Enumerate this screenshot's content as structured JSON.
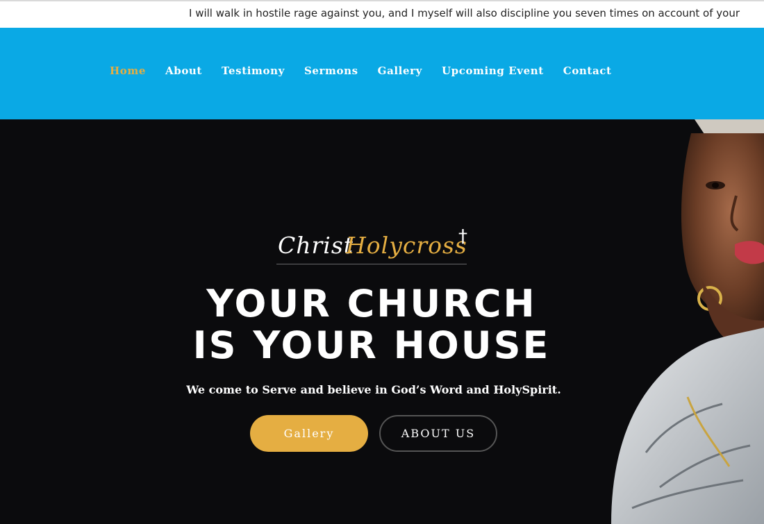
{
  "ticker": {
    "text": "I will walk in hostile rage against you, and I myself will also discipline you seven times on account of your"
  },
  "nav": {
    "items": [
      {
        "label": "Home",
        "active": true
      },
      {
        "label": "About",
        "active": false
      },
      {
        "label": "Testimony",
        "active": false
      },
      {
        "label": "Sermons",
        "active": false
      },
      {
        "label": "Gallery",
        "active": false
      },
      {
        "label": "Upcoming Event",
        "active": false
      },
      {
        "label": "Contact",
        "active": false
      }
    ]
  },
  "hero": {
    "brand": {
      "christ": "Christ",
      "holycross": "Holycross",
      "cross": "†"
    },
    "headline_line1": "YOUR CHURCH",
    "headline_line2": "IS YOUR HOUSE",
    "subtitle": "We come to Serve and believe in God’s Word and HolySpirit.",
    "buttons": {
      "gallery": "Gallery",
      "about": "ABOUT US"
    }
  },
  "colors": {
    "nav_bg": "#0aa9e5",
    "accent_gold": "#e5ae42",
    "hero_bg": "#0b0b0d",
    "white": "#ffffff"
  },
  "icons": {
    "brand_mark": "cross-icon"
  }
}
